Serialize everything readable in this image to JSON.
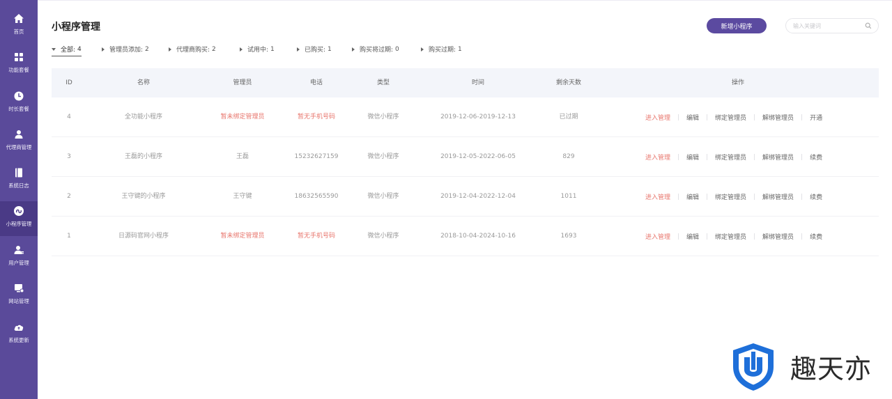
{
  "sidebar": {
    "items": [
      {
        "label": "首页",
        "icon": "home-icon"
      },
      {
        "label": "功能套餐",
        "icon": "grid-icon"
      },
      {
        "label": "时长套餐",
        "icon": "clock-icon"
      },
      {
        "label": "代理商管理",
        "icon": "agent-icon"
      },
      {
        "label": "系统日志",
        "icon": "log-icon"
      },
      {
        "label": "小程序管理",
        "icon": "miniprogram-icon",
        "active": true
      },
      {
        "label": "用户管理",
        "icon": "user-icon"
      },
      {
        "label": "网站管理",
        "icon": "website-icon"
      },
      {
        "label": "系统更新",
        "icon": "cloud-update-icon"
      }
    ]
  },
  "header": {
    "title": "小程序管理",
    "add_button": "新增小程序",
    "search_placeholder": "输入关键词"
  },
  "filters": [
    {
      "label": "全部:",
      "count": "4",
      "active": true
    },
    {
      "label": "管理员添加:",
      "count": "2"
    },
    {
      "label": "代理商购买:",
      "count": "2"
    },
    {
      "label": "试用中:",
      "count": "1"
    },
    {
      "label": "已购买:",
      "count": "1"
    },
    {
      "label": "购买将过期:",
      "count": "0"
    },
    {
      "label": "购买过期:",
      "count": "1"
    }
  ],
  "table": {
    "columns": [
      "ID",
      "名称",
      "管理员",
      "电话",
      "类型",
      "时间",
      "剩余天数",
      "操作"
    ],
    "rows": [
      {
        "id": "4",
        "name": "全功能小程序",
        "admin": "暂未绑定管理员",
        "admin_warn": true,
        "phone": "暂无手机号码",
        "phone_warn": true,
        "type": "微信小程序",
        "time": "2019-12-06-2019-12-13",
        "days": "已过期",
        "last_action": "开通"
      },
      {
        "id": "3",
        "name": "王磊的小程序",
        "admin": "王磊",
        "admin_warn": false,
        "phone": "15232627159",
        "phone_warn": false,
        "type": "微信小程序",
        "time": "2019-12-05-2022-06-05",
        "days": "829",
        "last_action": "续费"
      },
      {
        "id": "2",
        "name": "王守键的小程序",
        "admin": "王守键",
        "admin_warn": false,
        "phone": "18632565590",
        "phone_warn": false,
        "type": "微信小程序",
        "time": "2019-12-04-2022-12-04",
        "days": "1011",
        "last_action": "续费"
      },
      {
        "id": "1",
        "name": "日源码官网小程序",
        "admin": "暂未绑定管理员",
        "admin_warn": true,
        "phone": "暂无手机号码",
        "phone_warn": true,
        "type": "微信小程序",
        "time": "2018-10-04-2024-10-16",
        "days": "1693",
        "last_action": "续费"
      }
    ],
    "actions": {
      "enter": "进入管理",
      "edit": "编辑",
      "bind": "绑定管理员",
      "unbind": "解绑管理员"
    }
  },
  "watermark": {
    "text": "趣天亦"
  },
  "colors": {
    "sidebar": "#5a4a9a",
    "accent": "#5b4aa0",
    "warn": "#e8766d",
    "header_bg": "#f3f5fa"
  }
}
